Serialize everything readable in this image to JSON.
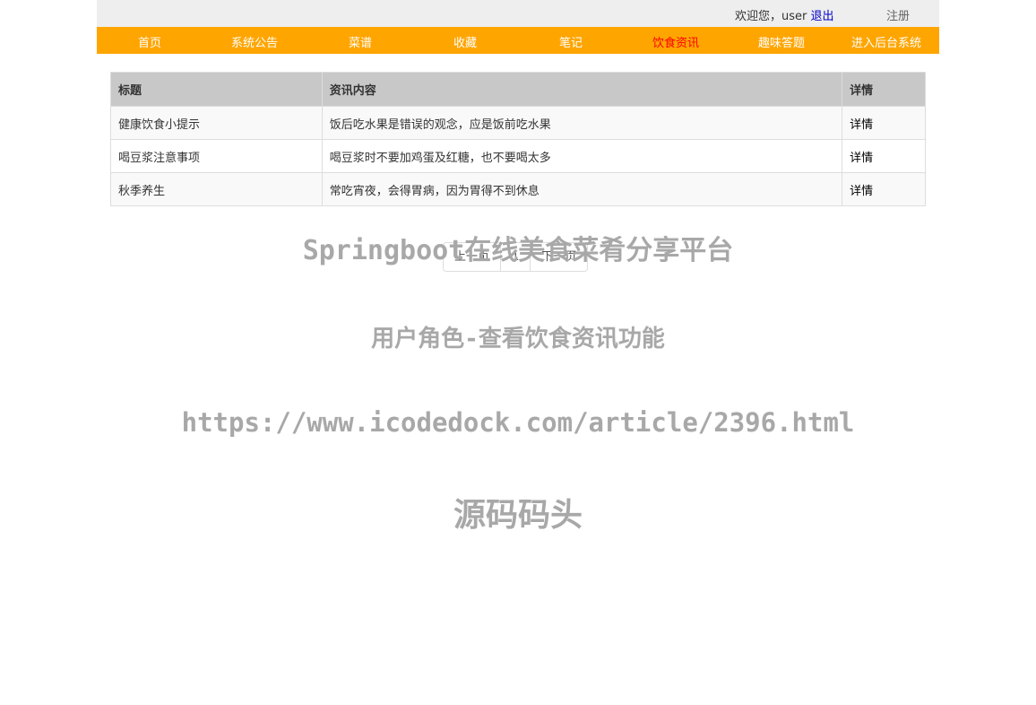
{
  "header": {
    "welcome_text": "欢迎您，user",
    "logout_label": "退出",
    "register_label": "注册"
  },
  "nav": {
    "items": [
      {
        "label": "首页"
      },
      {
        "label": "系统公告"
      },
      {
        "label": "菜谱"
      },
      {
        "label": "收藏"
      },
      {
        "label": "笔记"
      },
      {
        "label": "饮食资讯"
      },
      {
        "label": "趣味答题"
      },
      {
        "label": "进入后台系统"
      }
    ],
    "active_index": 5
  },
  "table": {
    "headers": [
      "标题",
      "资讯内容",
      "详情"
    ],
    "rows": [
      {
        "title": "健康饮食小提示",
        "content": "饭后吃水果是错误的观念，应是饭前吃水果",
        "detail": "详情"
      },
      {
        "title": "喝豆浆注意事项",
        "content": "喝豆浆时不要加鸡蛋及红糖，也不要喝太多",
        "detail": "详情"
      },
      {
        "title": "秋季养生",
        "content": "常吃宵夜，会得胃病，因为胃得不到休息",
        "detail": "详情"
      }
    ]
  },
  "pager": {
    "prev_label": "上一页",
    "current_page": "1",
    "next_label": "下一页"
  },
  "watermark": {
    "line1": "Springboot在线美食菜肴分享平台",
    "line2": "用户角色-查看饮食资讯功能",
    "line3": "https://www.icodedock.com/article/2396.html",
    "line4": "源码码头"
  },
  "colors": {
    "nav_bg": "#ffa500",
    "active_nav": "#ff0000",
    "logout_link": "#0000cc"
  }
}
